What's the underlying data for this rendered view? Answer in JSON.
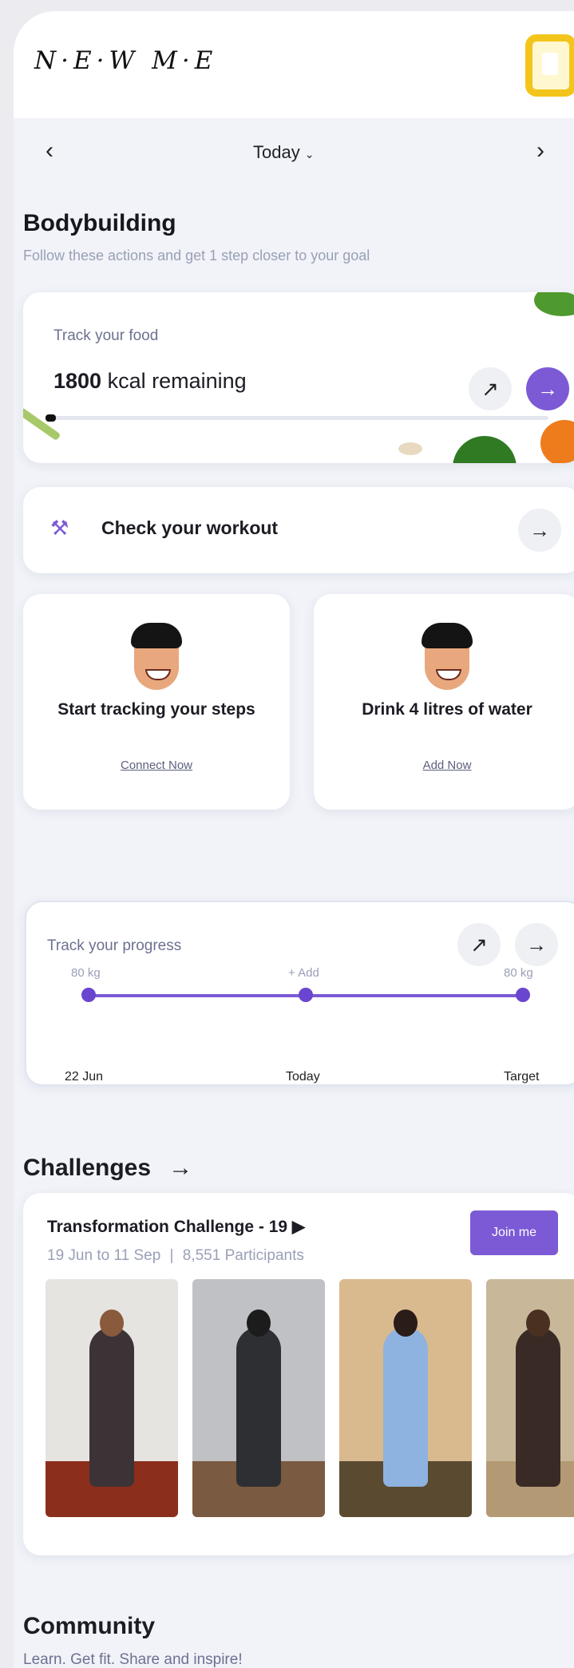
{
  "app": {
    "logo": "N·E·W M·E"
  },
  "date_nav": {
    "prev_icon": "‹",
    "label": "Today",
    "chevron": "⌄",
    "next_icon": "›"
  },
  "goal": {
    "title": "Bodybuilding",
    "subtitle": "Follow these actions and get 1 step closer to your goal"
  },
  "food": {
    "label": "Track your food",
    "kcal_value": "1800",
    "kcal_text": " kcal remaining",
    "trend_icon": "↗",
    "go_icon": "→",
    "progress_fraction": 0.02
  },
  "workout": {
    "label": "Check your workout",
    "go_icon": "→"
  },
  "tiles": [
    {
      "title": "Start tracking your steps",
      "link": "Connect Now"
    },
    {
      "title": "Drink 4 litres of water",
      "link": "Add Now"
    }
  ],
  "progress": {
    "label": "Track your progress",
    "trend_icon": "↗",
    "go_icon": "→",
    "points": [
      {
        "value": "80 kg",
        "label": "22 Jun"
      },
      {
        "value": "+ Add",
        "label": "Today"
      },
      {
        "value": "80 kg",
        "label": "Target"
      }
    ]
  },
  "challenges": {
    "title": "Challenges",
    "arrow": "→",
    "card": {
      "name": "Transformation Challenge - 19 ▶",
      "dates": "19 Jun to 11 Sep",
      "separator": "|",
      "participants": "8,551 Participants",
      "join_label": "Join me"
    }
  },
  "community": {
    "title": "Community",
    "subtitle": "Learn. Get fit. Share and inspire!"
  },
  "colors": {
    "accent": "#7c5ad6",
    "background": "#f1f3f9",
    "muted": "#9aa0b8"
  }
}
